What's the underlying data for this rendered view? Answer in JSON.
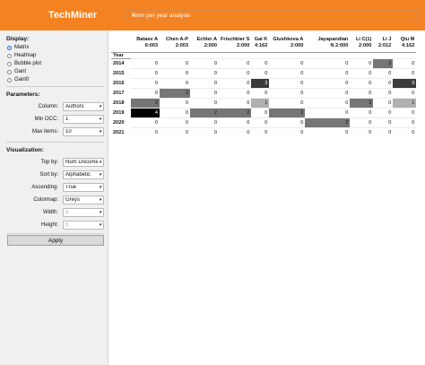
{
  "header": {
    "brand": "TechMiner",
    "selector_value": "Term per year analysis"
  },
  "sidebar": {
    "display_title": "Display:",
    "display_options": [
      "Matrix",
      "Heatmap",
      "Bubble plot",
      "Gant",
      "Gant0"
    ],
    "display_selected": "Matrix",
    "parameters_title": "Parameters:",
    "column_label": "Column:",
    "column_value": "Authors",
    "min_occ_label": "Min OCC:",
    "min_occ_value": "1",
    "max_items_label": "Max items:",
    "max_items_value": "10",
    "visualization_title": "Visualization:",
    "top_by_label": "Top by:",
    "top_by_value": "Num Documents",
    "sort_by_label": "Sort by:",
    "sort_by_value": "Alphabetic",
    "ascending_label": "Ascending:",
    "ascending_value": "True",
    "colormap_label": "Colormap:",
    "colormap_value": "Greys",
    "width_label": "Width:",
    "width_value": "5",
    "height_label": "Height:",
    "height_value": "5",
    "apply_label": "Apply"
  },
  "matrix": {
    "row_header": "Year",
    "columns": [
      [
        "Bataev A",
        "6:003"
      ],
      [
        "Chen A-P",
        "2:003"
      ],
      [
        "Echler A",
        "2:000"
      ],
      [
        "Frischbier S",
        "2:000"
      ],
      [
        "Gai K",
        "4:162"
      ],
      [
        "Glushkova A",
        "2:000"
      ],
      [
        "Jayapandian",
        "N 2:000"
      ],
      [
        "Li C(1)",
        "2:000"
      ],
      [
        "Li J",
        "2:012"
      ],
      [
        "Qiu M",
        "4:162"
      ]
    ],
    "rows": [
      {
        "year": "2014",
        "values": [
          0,
          0,
          0,
          0,
          0,
          0,
          0,
          0,
          2,
          0
        ]
      },
      {
        "year": "2015",
        "values": [
          0,
          0,
          0,
          0,
          0,
          0,
          0,
          0,
          0,
          0
        ]
      },
      {
        "year": "2016",
        "values": [
          0,
          0,
          0,
          0,
          3,
          0,
          0,
          0,
          0,
          3
        ]
      },
      {
        "year": "2017",
        "values": [
          0,
          2,
          0,
          0,
          0,
          0,
          0,
          0,
          0,
          0
        ]
      },
      {
        "year": "2018",
        "values": [
          2,
          0,
          0,
          0,
          1,
          0,
          0,
          2,
          0,
          1
        ]
      },
      {
        "year": "2019",
        "values": [
          4,
          0,
          2,
          2,
          0,
          2,
          0,
          0,
          0,
          0
        ]
      },
      {
        "year": "2020",
        "values": [
          0,
          0,
          0,
          0,
          0,
          0,
          2,
          0,
          0,
          0
        ]
      },
      {
        "year": "2021",
        "values": [
          0,
          0,
          0,
          0,
          0,
          0,
          0,
          0,
          0,
          0
        ]
      }
    ],
    "max_value": 4,
    "colormap": "Greys"
  }
}
